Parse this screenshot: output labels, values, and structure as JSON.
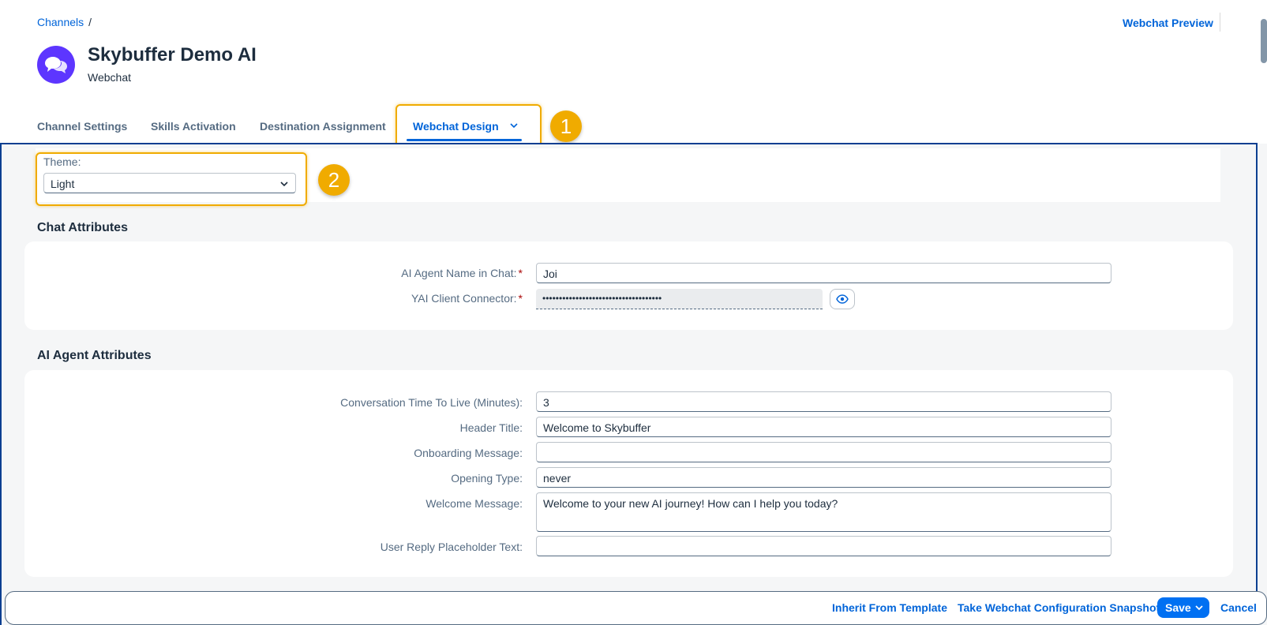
{
  "breadcrumb": {
    "link": "Channels",
    "separator": "/"
  },
  "header": {
    "title": "Skybuffer Demo AI",
    "subtitle": "Webchat",
    "preview_link": "Webchat Preview",
    "avatar_icon": "chat-bubbles-icon",
    "avatar_color": "#5d36ff"
  },
  "tabs": [
    {
      "label": "Channel Settings",
      "active": false
    },
    {
      "label": "Skills Activation",
      "active": false
    },
    {
      "label": "Destination Assignment",
      "active": false
    },
    {
      "label": "Webchat Design",
      "active": true
    }
  ],
  "annotations": {
    "badge1": "1",
    "badge2": "2",
    "color": "#f0ab00"
  },
  "theme": {
    "label": "Theme:",
    "value": "Light"
  },
  "chat_attributes": {
    "title": "Chat Attributes",
    "agent_name_label": "AI Agent Name in Chat:",
    "agent_name_value": "Joi",
    "connector_label": "YAI Client Connector:",
    "connector_value": "••••••••••••••••••••••••••••••••••••"
  },
  "agent_attributes": {
    "title": "AI Agent Attributes",
    "fields": [
      {
        "label": "Conversation Time To Live (Minutes):",
        "value": "3"
      },
      {
        "label": "Header Title:",
        "value": "Welcome to Skybuffer"
      },
      {
        "label": "Onboarding Message:",
        "value": ""
      },
      {
        "label": "Opening Type:",
        "value": "never"
      },
      {
        "label": "Welcome Message:",
        "value": "Welcome to your new AI journey! How can I help you today?"
      },
      {
        "label": "User Reply Placeholder Text:",
        "value": ""
      }
    ]
  },
  "footer": {
    "inherit": "Inherit From Template",
    "snapshot": "Take Webchat Configuration Snapshot",
    "save": "Save",
    "cancel": "Cancel"
  },
  "colors": {
    "accent": "#0064d9",
    "primary_button": "#0070f2",
    "required": "#aa0808"
  }
}
